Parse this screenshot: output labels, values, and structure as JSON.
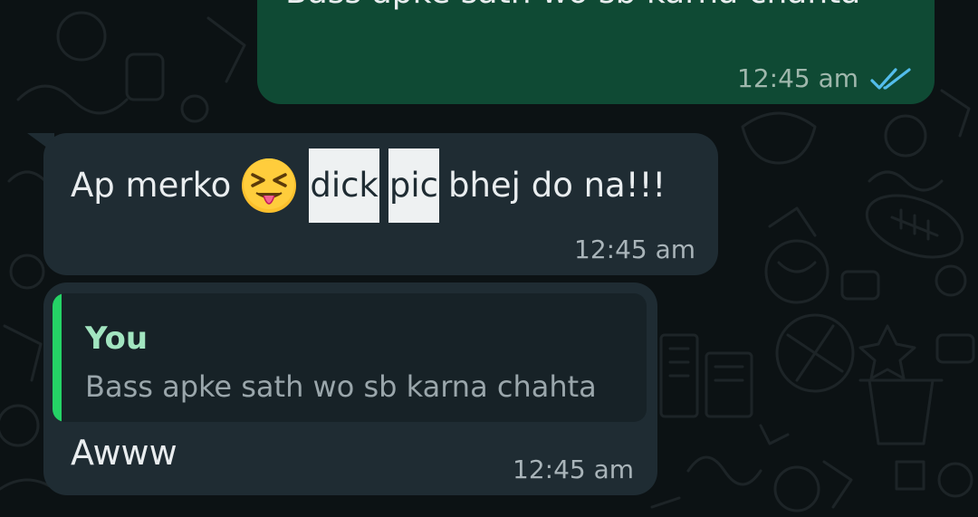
{
  "messages": [
    {
      "direction": "outgoing",
      "text": "Bass apke sath wo sb karna chahta",
      "time": "12:45 am",
      "status_icon": "double-check-read-icon"
    },
    {
      "direction": "incoming",
      "text_before": "Ap merko",
      "emoji": "squinting-face-with-tongue",
      "word_highlight_1": "dick",
      "word_highlight_2": "pic",
      "text_after": "bhej do na!!!",
      "time": "12:45 am"
    },
    {
      "direction": "incoming",
      "reply": {
        "author": "You",
        "text": "Bass apke sath wo sb karna chahta"
      },
      "text": "Awww",
      "time": "12:45 am"
    }
  ],
  "colors": {
    "chat_background": "#0c1214",
    "outgoing_bubble": "#0f4a34",
    "incoming_bubble": "#1f2c33",
    "reply_bar": "#25d366",
    "reply_author": "#a2e5c0",
    "read_ticks": "#53bdeb",
    "highlight": "#eef1f2"
  }
}
